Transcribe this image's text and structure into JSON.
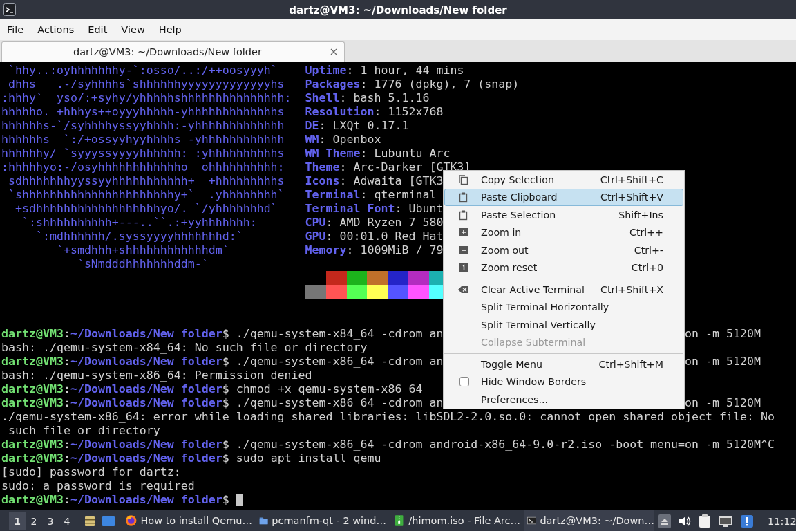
{
  "window": {
    "title": "dartz@VM3: ~/Downloads/New folder"
  },
  "menubar": [
    "File",
    "Actions",
    "Edit",
    "View",
    "Help"
  ],
  "tabs": [
    {
      "label": "dartz@VM3: ~/Downloads/New folder",
      "selected": true
    }
  ],
  "terminal": {
    "neofetch": [
      {
        "art": " `hhy..:oyhhhhhhhy-`:osso/..:/++oosyyyh`",
        "key": "Uptime",
        "value": ": 1 hour, 44 mins"
      },
      {
        "art": " dhhs   .-/syhhhhs`shhhhhhyyyyyyyyyyyyyhs",
        "key": "Packages",
        "value": ": 1776 (dpkg), 7 (snap)"
      },
      {
        "art": ":hhhy`  yso/:+syhy/yhhhhhshhhhhhhhhhhhhhh:",
        "key": "Shell",
        "value": ": bash 5.1.16"
      },
      {
        "art": "hhhhho. +hhhys++oyyyhhhhh-yhhhhhhhhhhhhhs",
        "key": "Resolution",
        "value": ": 1152x768"
      },
      {
        "art": "hhhhhhs-`/syhhhhyssyyhhhh:-yhhhhhhhhhhhhh",
        "key": "DE",
        "value": ": LXQt 0.17.1"
      },
      {
        "art": "hhhhhhs  `:/+ossyyhyyhhhhs -yhhhhhhhhhhhh",
        "key": "WM",
        "value": ": Openbox"
      },
      {
        "art": "hhhhhhy/ `syyyssyyyyhhhhhh: :yhhhhhhhhhhs",
        "key": "WM Theme",
        "value": ": Lubuntu Arc"
      },
      {
        "art": ":hhhhhyo:-/osyhhhhhhhhhhhho  ohhhhhhhhhh:",
        "key": "Theme",
        "value": ": Arc-Darker [GTK3]"
      },
      {
        "art": " sdhhhhhhhyyssyyhhhhhhhhhhh+  +hhhhhhhhhs",
        "key": "Icons",
        "value": ": Adwaita [GTK3"
      },
      {
        "art": " `shhhhhhhhhhhhhhhhhhhhhhy+`  .yhhhhhhhh`",
        "key": "Terminal",
        "value": ": qterminal"
      },
      {
        "art": "  +sdhhhhhhhhhhhhhhhhhhyo/. `/yhhhhhhhd`",
        "key": "Terminal Font",
        "value": ": Ubunt"
      },
      {
        "art": "   `:shhhhhhhhhh+---..``.:+yyhhhhhhh:",
        "key": "CPU",
        "value": ": AMD Ryzen 7 580"
      },
      {
        "art": "     `:mdhhhhhh/.syssyyyyhhhhhhhd:`",
        "key": "GPU",
        "value": ": 00:01.0 Red Hat"
      },
      {
        "art": "        `+smdhhh+shhhhhhhhhhhhdm`",
        "key": "Memory",
        "value": ": 1009MiB / 79"
      },
      {
        "art": "           `sNmdddhhhhhhhddm-`"
      }
    ],
    "palette": [
      {
        "swatches": [
          {
            "color": "#c4281c"
          },
          {
            "color": "#1cb31c"
          },
          {
            "color": "#c0702a"
          },
          {
            "color": "#2424c8"
          },
          {
            "color": "#b42cc0"
          },
          {
            "color": "#1cb0b0"
          }
        ]
      },
      {
        "swatches": [
          {
            "color": "#767676"
          },
          {
            "color": "#ff5454"
          },
          {
            "color": "#54ff54"
          },
          {
            "color": "#ffff54"
          },
          {
            "color": "#5454ff"
          },
          {
            "color": "#ff54ff"
          },
          {
            "color": "#54ffff"
          }
        ]
      }
    ],
    "lines": [
      {
        "kind": "prompt",
        "user": "dartz@VM3",
        "sep": ":",
        "path": "~/Downloads/New folder",
        "sigil": "$",
        "command": "./qemu-system-x84_64 -cdrom an",
        "tail": "on -m 5120M",
        "cursor": false
      },
      {
        "kind": "output",
        "text": "bash: ./qemu-system-x84_64: No such file or directory"
      },
      {
        "kind": "prompt",
        "user": "dartz@VM3",
        "sep": ":",
        "path": "~/Downloads/New folder",
        "sigil": "$",
        "command": "./qemu-system-x86_64 -cdrom an",
        "tail": "on -m 5120M",
        "cursor": false
      },
      {
        "kind": "output",
        "text": "bash: ./qemu-system-x86_64: Permission denied"
      },
      {
        "kind": "prompt",
        "user": "dartz@VM3",
        "sep": ":",
        "path": "~/Downloads/New folder",
        "sigil": "$",
        "command": "chmod +x qemu-system-x86_64",
        "cursor": false
      },
      {
        "kind": "prompt",
        "user": "dartz@VM3",
        "sep": ":",
        "path": "~/Downloads/New folder",
        "sigil": "$",
        "command": "./qemu-system-x86_64 -cdrom an",
        "tail": "on -m 5120M",
        "cursor": false
      },
      {
        "kind": "output",
        "text": "./qemu-system-x86_64: error while loading shared libraries: libSDL2-2.0.so.0: cannot open shared object file: No"
      },
      {
        "kind": "output",
        "text": " such file or directory"
      },
      {
        "kind": "prompt",
        "user": "dartz@VM3",
        "sep": ":",
        "path": "~/Downloads/New folder",
        "sigil": "$",
        "command": "./qemu-system-x86_64 -cdrom android-x86_64-9.0-r2.iso -boot menu=on -m 5120M^C",
        "cursor": false
      },
      {
        "kind": "prompt",
        "user": "dartz@VM3",
        "sep": ":",
        "path": "~/Downloads/New folder",
        "sigil": "$",
        "command": "sudo apt install qemu",
        "cursor": false
      },
      {
        "kind": "output",
        "text": "[sudo] password for dartz:"
      },
      {
        "kind": "output",
        "text": "sudo: a password is required"
      },
      {
        "kind": "prompt",
        "user": "dartz@VM3",
        "sep": ":",
        "path": "~/Downloads/New folder",
        "sigil": "$",
        "cursor": true
      }
    ]
  },
  "context_menu": {
    "items": [
      {
        "kind": "copy",
        "label": "Copy Selection",
        "shortcut": "Ctrl+Shift+C",
        "selected": false,
        "disabled": false
      },
      {
        "kind": "paste",
        "label": "Paste Clipboard",
        "shortcut": "Ctrl+Shift+V",
        "selected": true,
        "disabled": false
      },
      {
        "kind": "paste",
        "label": "Paste Selection",
        "shortcut": "Shift+Ins",
        "selected": false,
        "disabled": false
      },
      {
        "kind": "zoom-in",
        "label": "Zoom in",
        "shortcut": "Ctrl++",
        "selected": false,
        "disabled": false
      },
      {
        "kind": "zoom-out",
        "label": "Zoom out",
        "shortcut": "Ctrl+-",
        "selected": false,
        "disabled": false
      },
      {
        "kind": "zoom-reset",
        "label": "Zoom reset",
        "shortcut": "Ctrl+0",
        "selected": false,
        "disabled": false
      },
      {
        "kind": "separator"
      },
      {
        "kind": "clear",
        "label": "Clear Active Terminal",
        "shortcut": "Ctrl+Shift+X",
        "selected": false,
        "disabled": false
      },
      {
        "kind": "plain",
        "label": "Split Terminal Horizontally",
        "selected": false,
        "disabled": false
      },
      {
        "kind": "plain",
        "label": "Split Terminal Vertically",
        "selected": false,
        "disabled": false
      },
      {
        "kind": "plain",
        "label": "Collapse Subterminal",
        "selected": false,
        "disabled": true
      },
      {
        "kind": "separator"
      },
      {
        "kind": "plain",
        "label": "Toggle Menu",
        "shortcut": "Ctrl+Shift+M",
        "selected": false,
        "disabled": false
      },
      {
        "kind": "check",
        "label": "Hide Window Borders",
        "checked": false,
        "selected": false,
        "disabled": false
      },
      {
        "kind": "plain",
        "label": "Preferences...",
        "selected": false,
        "disabled": false
      }
    ]
  },
  "taskbar": {
    "workspaces": [
      {
        "label": "1",
        "selected": true
      },
      {
        "label": "2",
        "selected": false
      },
      {
        "label": "3",
        "selected": false
      },
      {
        "label": "4",
        "selected": false
      }
    ],
    "tasks": [
      {
        "kind": "browser",
        "label": "How to install Qemu…",
        "selected": false
      },
      {
        "kind": "folder",
        "label": "pcmanfm-qt - 2 wind…",
        "selected": false
      },
      {
        "kind": "archive",
        "label": "/himom.iso - File Arc…",
        "selected": false
      },
      {
        "kind": "terminal",
        "label": "dartz@VM3: ~/Down…",
        "selected": true
      }
    ],
    "clock": "11:12"
  }
}
